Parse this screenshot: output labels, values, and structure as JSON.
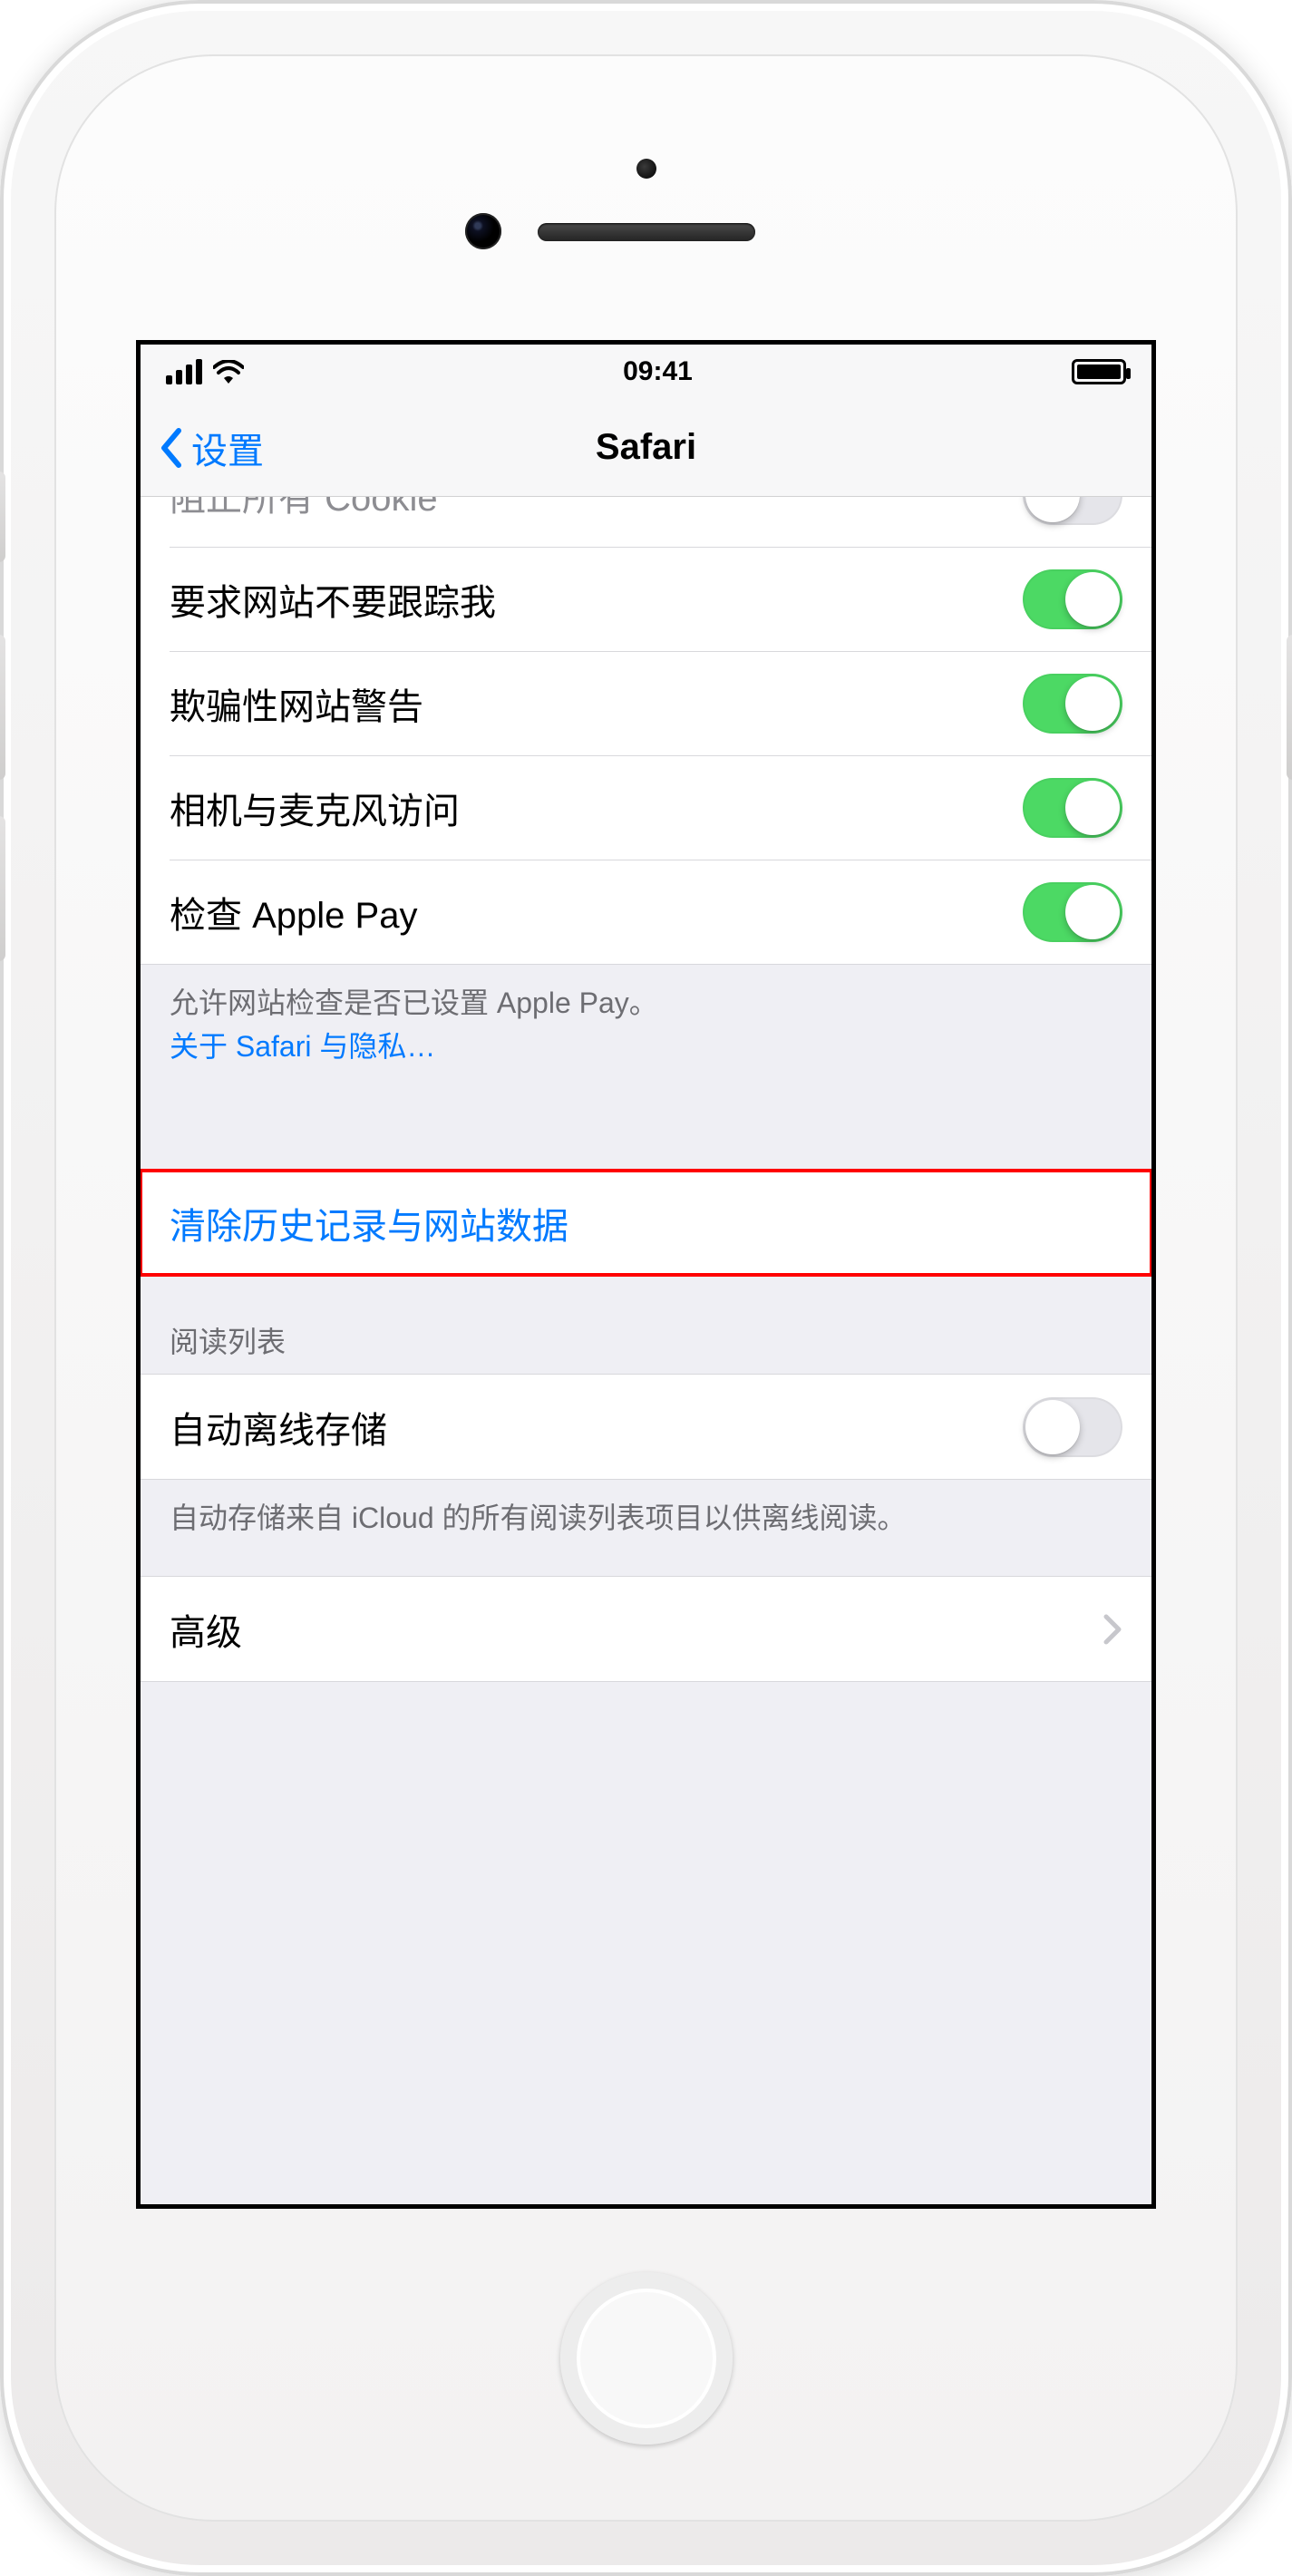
{
  "status": {
    "time": "09:41"
  },
  "nav": {
    "back_label": "设置",
    "title": "Safari"
  },
  "rows": {
    "row_cut": {
      "label": "阻止所有 Cookie",
      "on": false
    },
    "do_not_track": {
      "label": "要求网站不要跟踪我",
      "on": true
    },
    "fraud_warning": {
      "label": "欺骗性网站警告",
      "on": true
    },
    "camera_mic": {
      "label": "相机与麦克风访问",
      "on": true
    },
    "apple_pay": {
      "label": "检查 Apple Pay",
      "on": true
    }
  },
  "apple_pay_footer": {
    "text": "允许网站检查是否已设置 Apple Pay。",
    "link": "关于 Safari 与隐私…"
  },
  "clear_data": {
    "label": "清除历史记录与网站数据"
  },
  "reading_list": {
    "header": "阅读列表",
    "auto_offline": {
      "label": "自动离线存储",
      "on": false
    },
    "footer": "自动存储来自 iCloud 的所有阅读列表项目以供离线阅读。"
  },
  "advanced": {
    "label": "高级"
  }
}
